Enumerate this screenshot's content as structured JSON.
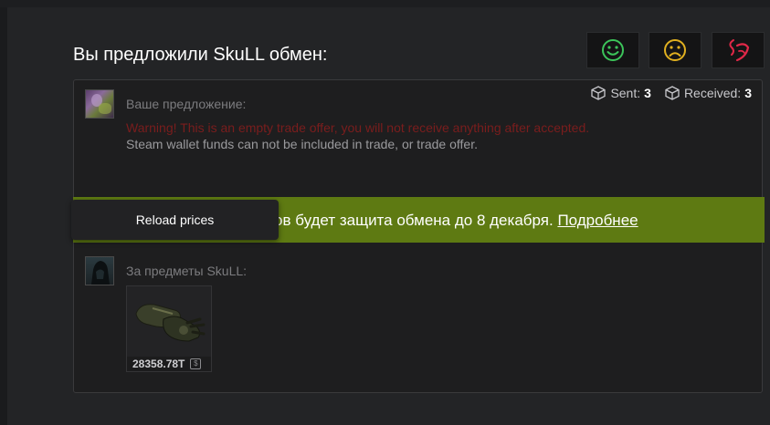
{
  "title": "Вы предложили SkuLL обмен:",
  "reactions": [
    {
      "name": "happy-face-icon",
      "color": "#3cc45a"
    },
    {
      "name": "sad-face-icon",
      "color": "#e0b020"
    },
    {
      "name": "angry-icon",
      "color": "#e02848"
    }
  ],
  "stats": {
    "sent_label": "Sent:",
    "sent_value": "3",
    "received_label": "Received:",
    "received_value": "3"
  },
  "your_offer": {
    "label": "Ваше предложение:",
    "warning": "Warning! This is an empty trade offer, you will not receive anything after accepted.",
    "info": "Steam wallet funds can not be included in trade, or trade offer."
  },
  "banner": {
    "text": "ов будет защита обмена до 8 декабря.",
    "link": "Подробнее"
  },
  "reload_button": "Reload prices",
  "their_offer": {
    "label": "За предметы SkuLL:",
    "items": [
      {
        "price": "28358.78T",
        "icon": "gloves-icon"
      }
    ]
  }
}
